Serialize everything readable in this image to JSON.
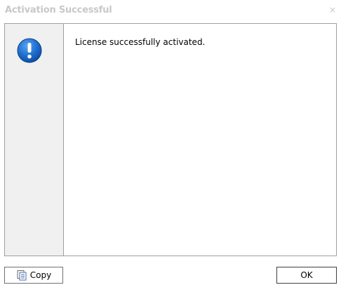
{
  "dialog": {
    "title": "Activation Successful",
    "close_glyph": "×",
    "message": "License successfully activated.",
    "icon": "exclamation-icon"
  },
  "buttons": {
    "copy_label": "Copy",
    "ok_label": "OK"
  },
  "colors": {
    "icon_blue": "#1e6fd0",
    "strip_bg": "#f0f0f0",
    "title_text": "#c8c8c8"
  }
}
